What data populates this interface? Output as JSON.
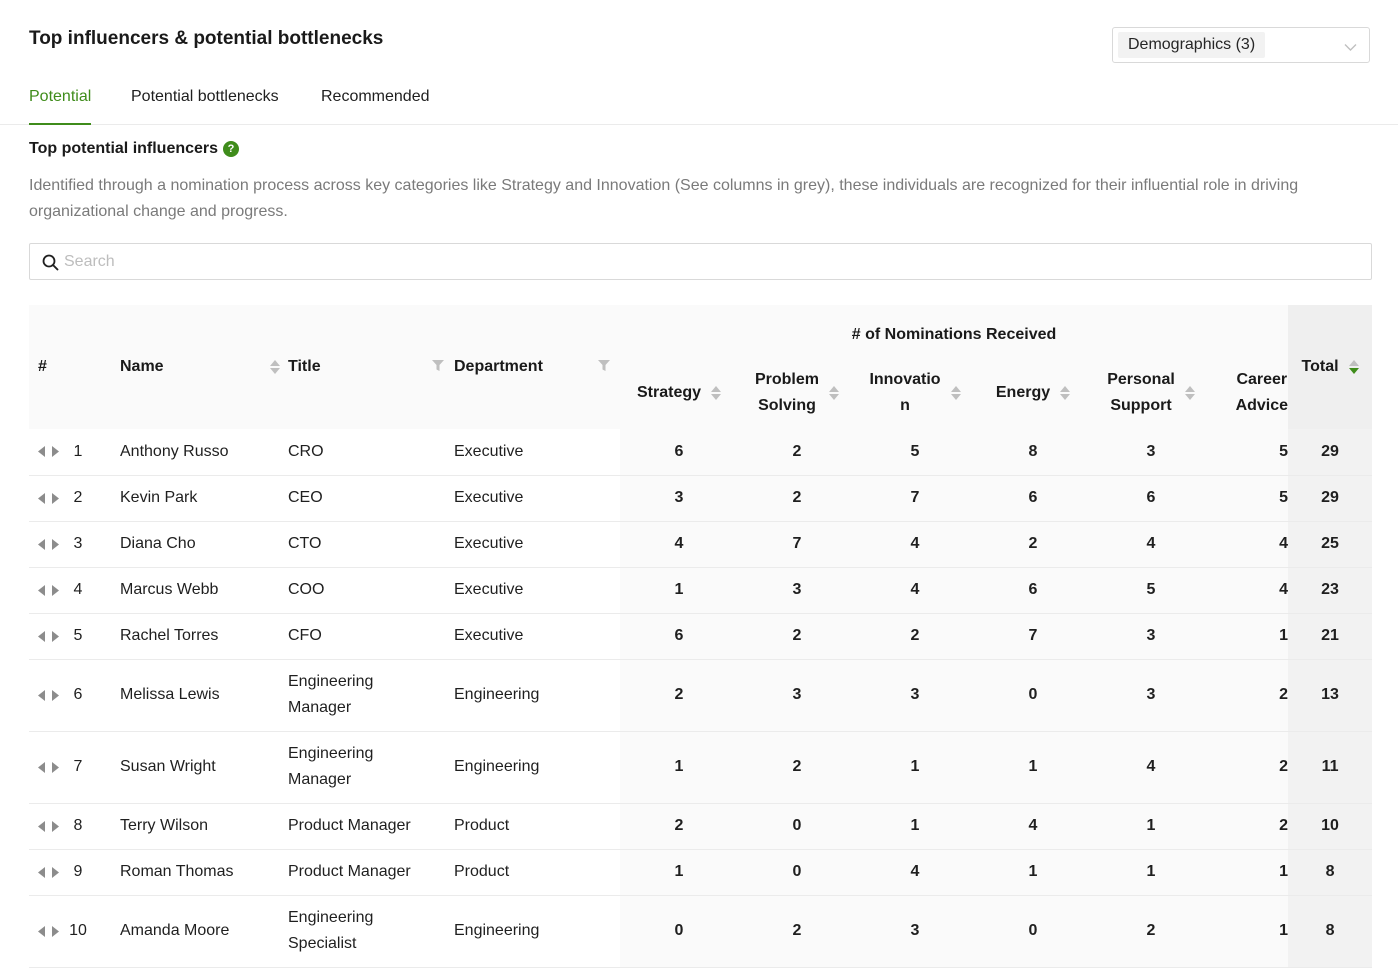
{
  "header": {
    "title": "Top influencers & potential bottlenecks",
    "demographics_label": "Demographics (3)"
  },
  "tabs": [
    {
      "label": "Potential",
      "active": true
    },
    {
      "label": "Potential bottlenecks",
      "active": false
    },
    {
      "label": "Recommended",
      "active": false
    }
  ],
  "section": {
    "title": "Top potential influencers",
    "help_icon": "?",
    "description": "Identified through a nomination process across key categories like Strategy and Innovation (See columns in grey), these individuals are recognized for their influential role in driving organizational change and progress."
  },
  "search": {
    "placeholder": "Search",
    "value": ""
  },
  "colors": {
    "accent": "#3f8c1b",
    "header_bg": "#fafafa",
    "total_bg": "#efefef"
  },
  "table": {
    "group_header": "# of Nominations Received",
    "columns": {
      "rank": "#",
      "name": "Name",
      "title": "Title",
      "department": "Department",
      "strategy": [
        "Strategy"
      ],
      "problem_solving": [
        "Problem",
        "Solving"
      ],
      "innovation": [
        "Innovatio",
        "n"
      ],
      "energy": [
        "Energy"
      ],
      "personal_support": [
        "Personal",
        "Support"
      ],
      "career_advice": [
        "Career",
        "Advice"
      ],
      "total": "Total"
    },
    "rows": [
      {
        "rank": "1",
        "name": "Anthony Russo",
        "title": [
          "CRO"
        ],
        "department": "Executive",
        "strategy": "6",
        "problem_solving": "2",
        "innovation": "5",
        "energy": "8",
        "personal_support": "3",
        "career_advice": "5",
        "total": "29"
      },
      {
        "rank": "2",
        "name": "Kevin Park",
        "title": [
          "CEO"
        ],
        "department": "Executive",
        "strategy": "3",
        "problem_solving": "2",
        "innovation": "7",
        "energy": "6",
        "personal_support": "6",
        "career_advice": "5",
        "total": "29"
      },
      {
        "rank": "3",
        "name": "Diana Cho",
        "title": [
          "CTO"
        ],
        "department": "Executive",
        "strategy": "4",
        "problem_solving": "7",
        "innovation": "4",
        "energy": "2",
        "personal_support": "4",
        "career_advice": "4",
        "total": "25"
      },
      {
        "rank": "4",
        "name": "Marcus Webb",
        "title": [
          "COO"
        ],
        "department": "Executive",
        "strategy": "1",
        "problem_solving": "3",
        "innovation": "4",
        "energy": "6",
        "personal_support": "5",
        "career_advice": "4",
        "total": "23"
      },
      {
        "rank": "5",
        "name": "Rachel Torres",
        "title": [
          "CFO"
        ],
        "department": "Executive",
        "strategy": "6",
        "problem_solving": "2",
        "innovation": "2",
        "energy": "7",
        "personal_support": "3",
        "career_advice": "1",
        "total": "21"
      },
      {
        "rank": "6",
        "name": "Melissa Lewis",
        "title": [
          "Engineering",
          "Manager"
        ],
        "department": "Engineering",
        "strategy": "2",
        "problem_solving": "3",
        "innovation": "3",
        "energy": "0",
        "personal_support": "3",
        "career_advice": "2",
        "total": "13"
      },
      {
        "rank": "7",
        "name": "Susan Wright",
        "title": [
          "Engineering",
          "Manager"
        ],
        "department": "Engineering",
        "strategy": "1",
        "problem_solving": "2",
        "innovation": "1",
        "energy": "1",
        "personal_support": "4",
        "career_advice": "2",
        "total": "11"
      },
      {
        "rank": "8",
        "name": "Terry Wilson",
        "title": [
          "Product Manager"
        ],
        "department": "Product",
        "strategy": "2",
        "problem_solving": "0",
        "innovation": "1",
        "energy": "4",
        "personal_support": "1",
        "career_advice": "2",
        "total": "10"
      },
      {
        "rank": "9",
        "name": "Roman Thomas",
        "title": [
          "Product Manager"
        ],
        "department": "Product",
        "strategy": "1",
        "problem_solving": "0",
        "innovation": "4",
        "energy": "1",
        "personal_support": "1",
        "career_advice": "1",
        "total": "8"
      },
      {
        "rank": "10",
        "name": "Amanda Moore",
        "title": [
          "Engineering",
          "Specialist"
        ],
        "department": "Engineering",
        "strategy": "0",
        "problem_solving": "2",
        "innovation": "3",
        "energy": "0",
        "personal_support": "2",
        "career_advice": "1",
        "total": "8"
      }
    ]
  }
}
